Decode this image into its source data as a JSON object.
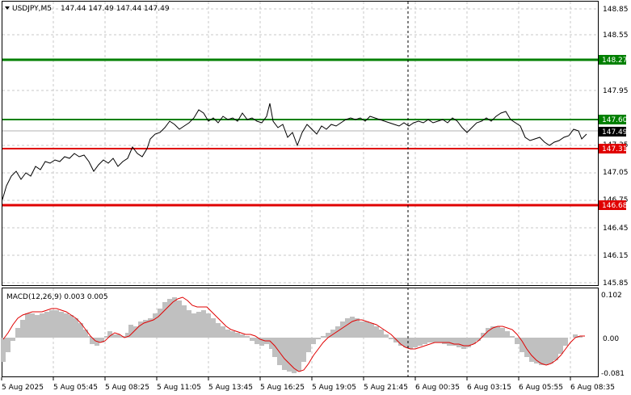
{
  "header": {
    "symbol": "USDJPY,M5",
    "ohlc": "147.44 147.49 147.44 147.49"
  },
  "macd": {
    "label": "MACD(12,26,9) 0.003 0.005",
    "axis_labels": [
      "0.102",
      "0.00",
      "-0.081"
    ]
  },
  "price_axis": {
    "labels": [
      "148.85",
      "148.55",
      "147.95",
      "147.35",
      "147.05",
      "146.75",
      "146.45",
      "146.15",
      "145.85"
    ]
  },
  "levels": [
    {
      "label": "148.27",
      "color": "#008000",
      "thick": true
    },
    {
      "label": "147.60",
      "color": "#008000",
      "thick": false
    },
    {
      "label": "147.31",
      "color": "#e00000",
      "thick": false
    },
    {
      "label": "146.68",
      "color": "#e00000",
      "thick": true
    }
  ],
  "current_price": {
    "label": "147.49"
  },
  "time_axis": {
    "labels": [
      "5 Aug 2025",
      "5 Aug 05:45",
      "5 Aug 08:25",
      "5 Aug 11:05",
      "5 Aug 13:45",
      "5 Aug 16:25",
      "5 Aug 19:05",
      "5 Aug 21:45",
      "6 Aug 00:35",
      "6 Aug 03:15",
      "6 Aug 05:55",
      "6 Aug 08:35"
    ]
  },
  "colors": {
    "buy_level": "#008000",
    "sell_level": "#e00000",
    "price_line": "#000000",
    "macd_hist": "#c0c0c0",
    "macd_signal": "#e00000",
    "grid": "#c8c8c8"
  }
}
